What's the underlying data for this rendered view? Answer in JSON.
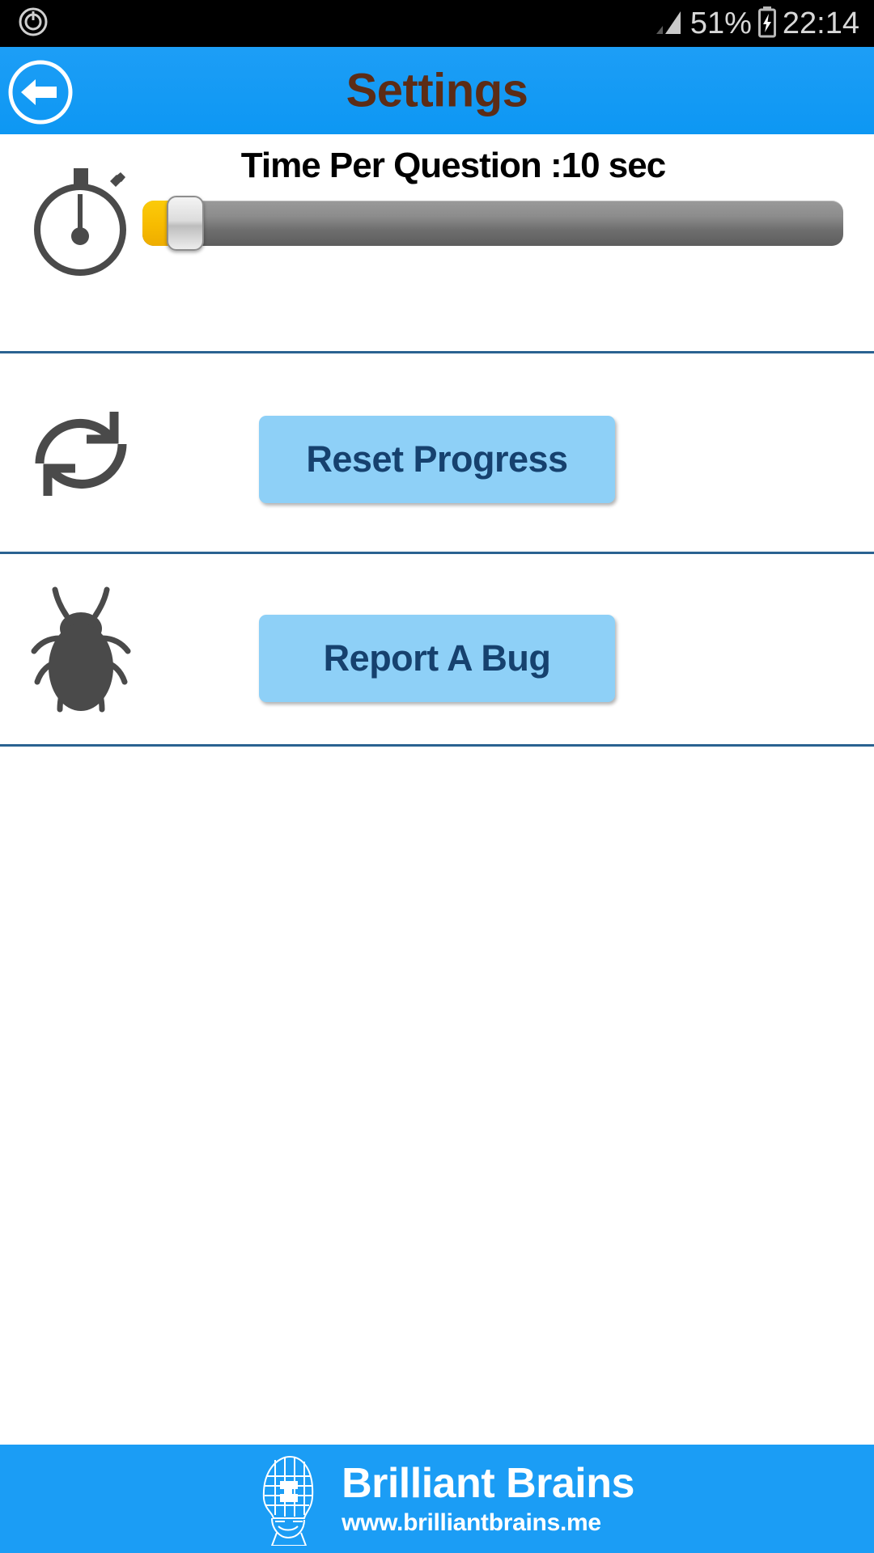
{
  "status_bar": {
    "left_icon": "power-clock-icon",
    "signal_icon": "signal-bars-icon",
    "battery_percent": "51%",
    "battery_icon": "battery-charging-icon",
    "time": "22:14"
  },
  "app_bar": {
    "back_icon": "back-arrow-icon",
    "title": "Settings",
    "background_color": "#1b9df5",
    "title_color": "#5c2c16"
  },
  "settings": {
    "time_per_question": {
      "icon": "stopwatch-icon",
      "label": "Time Per Question :10 sec",
      "value_seconds": 10,
      "slider": {
        "fill_color": "#f7bb00",
        "track_color": "#6e6e6e",
        "percent": 6
      }
    },
    "reset_progress": {
      "icon": "refresh-icon",
      "button_label": "Reset Progress"
    },
    "report_bug": {
      "icon": "bug-icon",
      "button_label": "Report A Bug"
    },
    "divider_color": "#2a6291",
    "button_color": "#8ed0f7",
    "button_text_color": "#16416e"
  },
  "footer": {
    "logo_icon": "brain-head-logo-icon",
    "brand": "Brilliant Brains",
    "url": "www.brilliantbrains.me"
  }
}
